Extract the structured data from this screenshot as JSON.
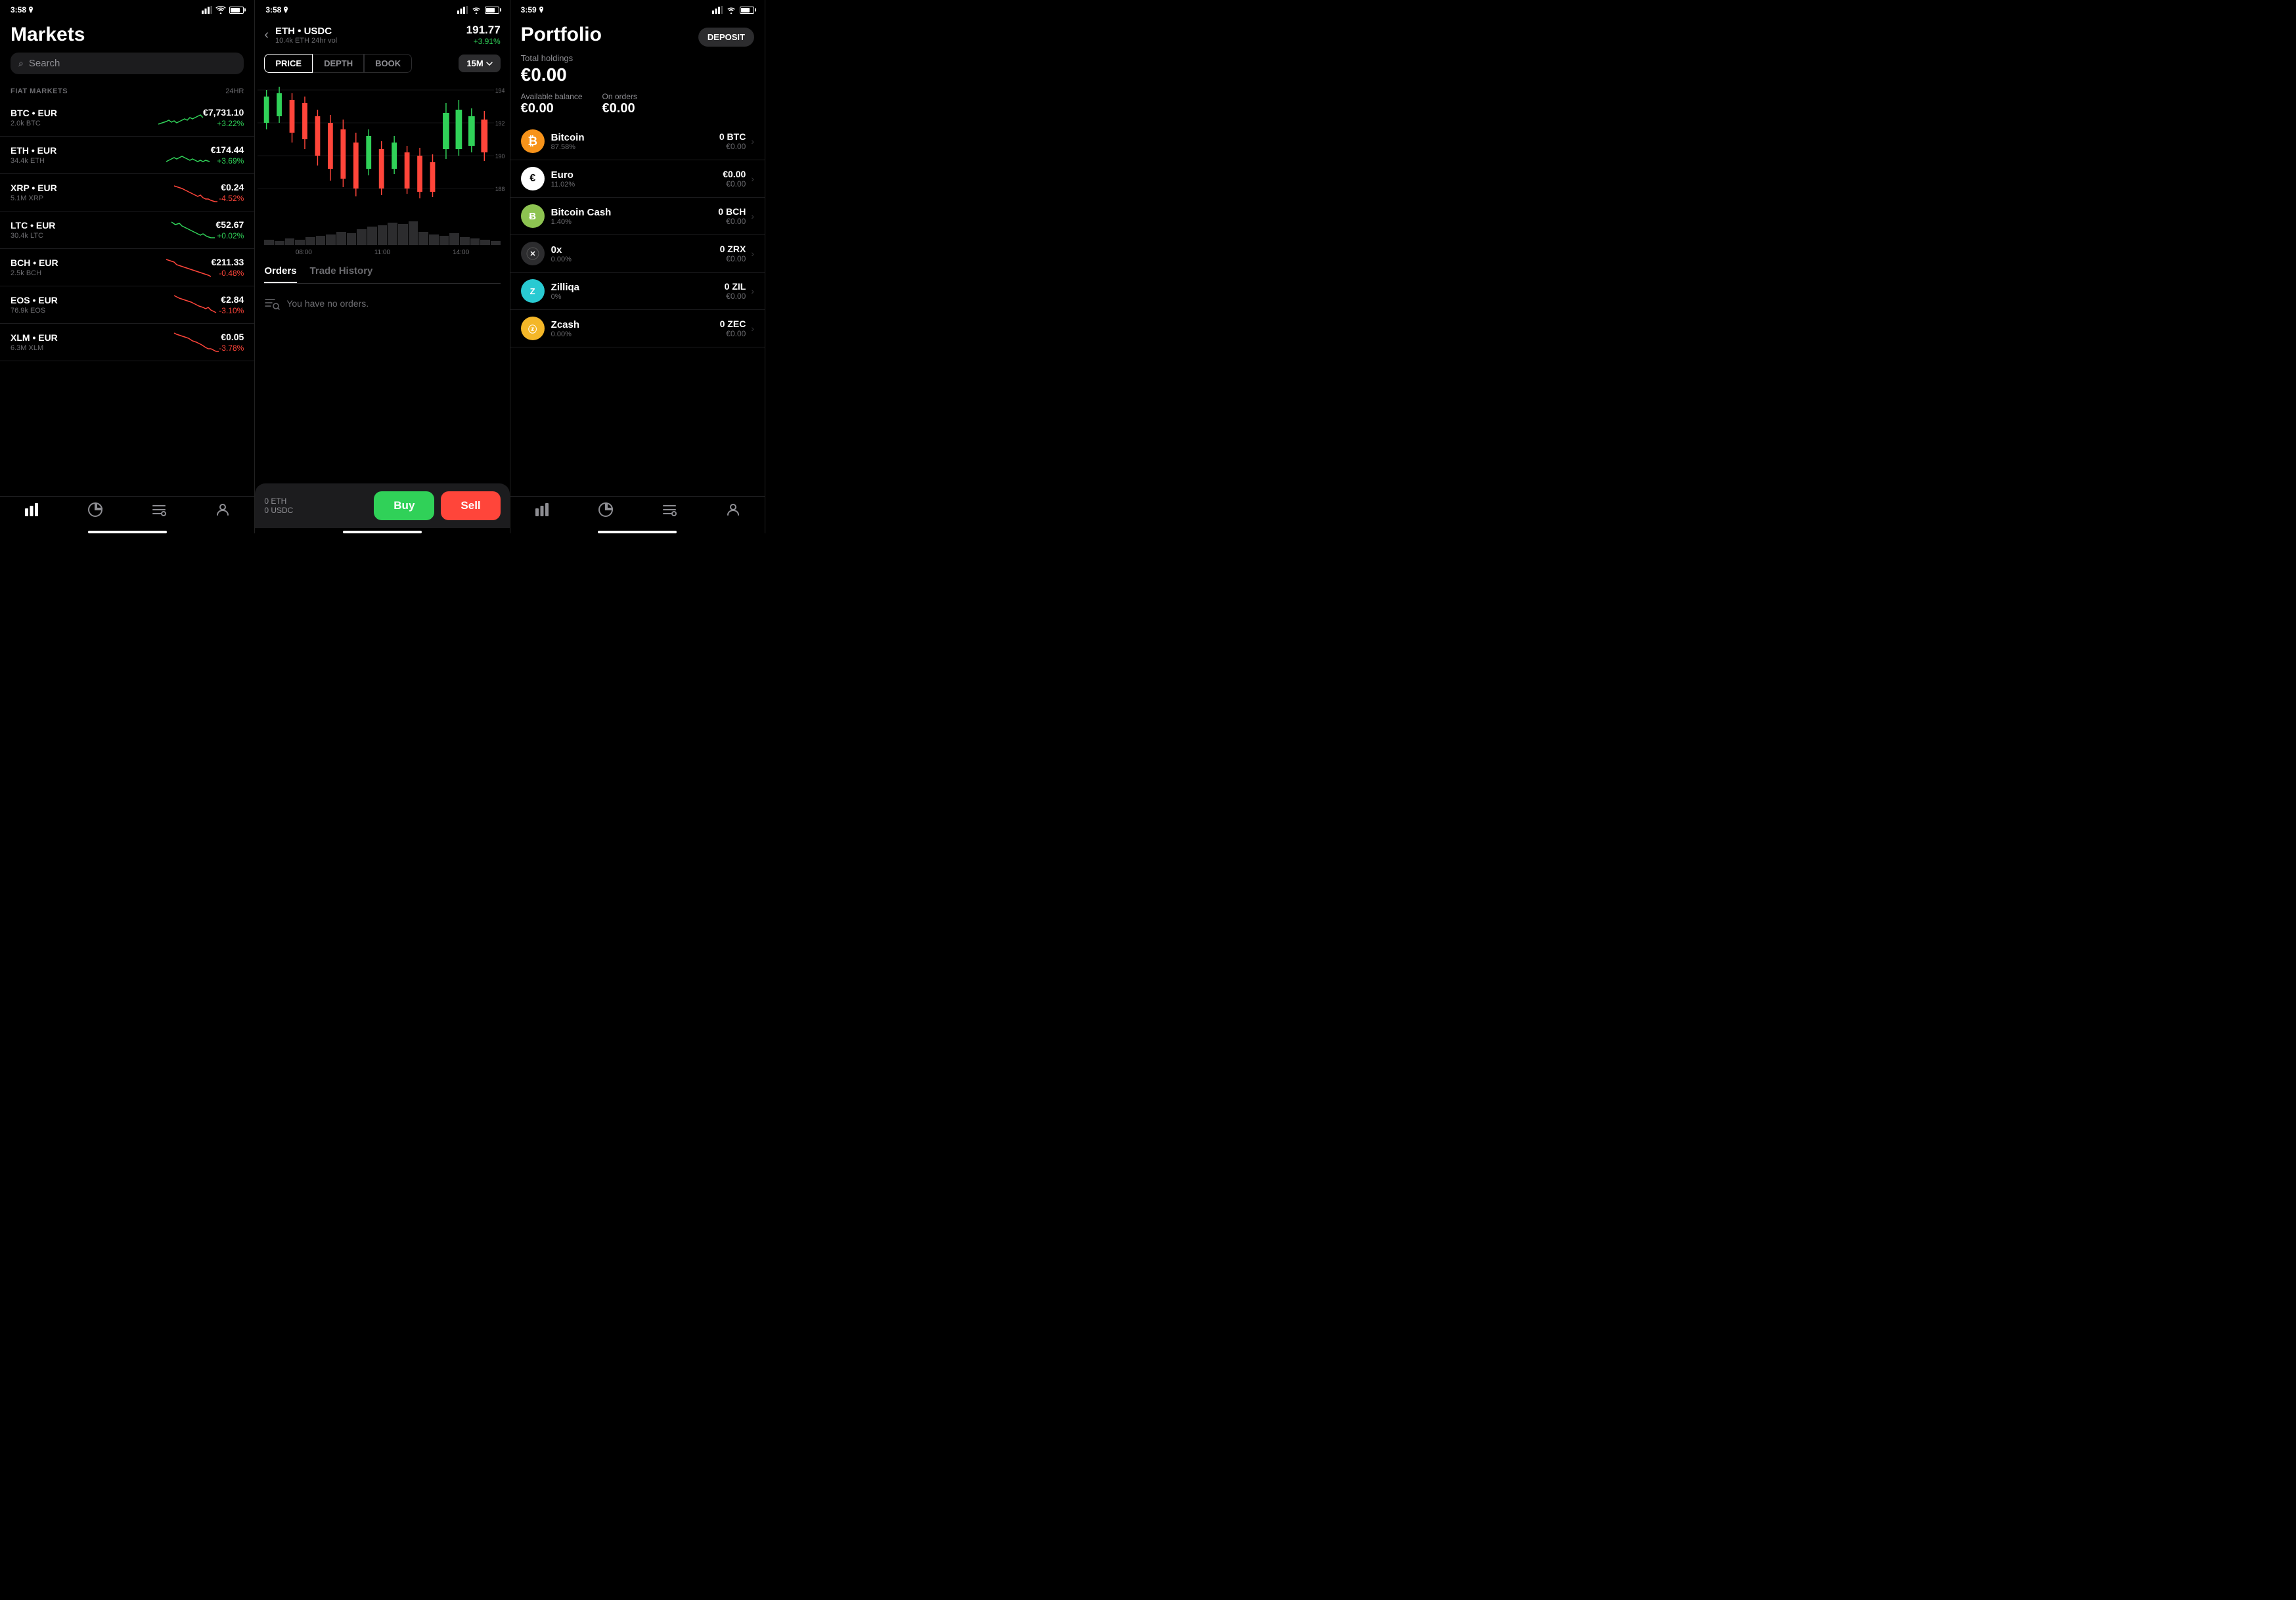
{
  "screens": {
    "markets": {
      "status_time": "3:58",
      "title": "Markets",
      "search_placeholder": "Search",
      "section_label": "FIAT MARKETS",
      "section_24hr": "24HR",
      "items": [
        {
          "pair": "BTC • EUR",
          "vol": "2.0k BTC",
          "price": "€7,731.10",
          "change": "+3.22%",
          "positive": true
        },
        {
          "pair": "ETH • EUR",
          "vol": "34.4k ETH",
          "price": "€174.44",
          "change": "+3.69%",
          "positive": true
        },
        {
          "pair": "XRP • EUR",
          "vol": "5.1M XRP",
          "price": "€0.24",
          "change": "-4.52%",
          "positive": false
        },
        {
          "pair": "LTC • EUR",
          "vol": "30.4k LTC",
          "price": "€52.67",
          "change": "+0.02%",
          "positive": true
        },
        {
          "pair": "BCH • EUR",
          "vol": "2.5k BCH",
          "price": "€211.33",
          "change": "-0.48%",
          "positive": false
        },
        {
          "pair": "EOS • EUR",
          "vol": "76.9k EOS",
          "price": "€2.84",
          "change": "-3.10%",
          "positive": false
        },
        {
          "pair": "XLM • EUR",
          "vol": "6.3M XLM",
          "price": "€0.05",
          "change": "-3.78%",
          "positive": false
        }
      ],
      "nav": [
        "markets",
        "portfolio",
        "orders",
        "account"
      ]
    },
    "trading": {
      "status_time": "3:58",
      "pair_name": "ETH • USDC",
      "pair_vol": "10.4k ETH 24hr vol",
      "price": "191.77",
      "price_change": "+3.91%",
      "tabs": [
        "PRICE",
        "DEPTH",
        "BOOK"
      ],
      "active_tab": "PRICE",
      "timeframe": "15M",
      "price_levels": [
        "194",
        "192",
        "190",
        "188"
      ],
      "time_labels": [
        "08:00",
        "11:00",
        "14:00"
      ],
      "orders_tabs": [
        "Orders",
        "Trade History"
      ],
      "no_orders_text": "You have no orders.",
      "eth_balance": "0 ETH",
      "usdc_balance": "0 USDC",
      "buy_label": "Buy",
      "sell_label": "Sell"
    },
    "portfolio": {
      "status_time": "3:59",
      "title": "Portfolio",
      "deposit_label": "DEPOSIT",
      "total_label": "Total holdings",
      "total_value": "€0.00",
      "available_label": "Available balance",
      "available_value": "€0.00",
      "on_orders_label": "On orders",
      "on_orders_value": "€0.00",
      "assets": [
        {
          "name": "Bitcoin",
          "pct": "87.58%",
          "crypto": "0 BTC",
          "fiat": "€0.00",
          "type": "btc",
          "symbol": "₿"
        },
        {
          "name": "Euro",
          "pct": "11.02%",
          "crypto": "€0.00",
          "fiat": "€0.00",
          "type": "eur",
          "symbol": "€"
        },
        {
          "name": "Bitcoin Cash",
          "pct": "1.40%",
          "crypto": "0 BCH",
          "fiat": "€0.00",
          "type": "bch",
          "symbol": "Ƀ"
        },
        {
          "name": "0x",
          "pct": "0.00%",
          "crypto": "0 ZRX",
          "fiat": "€0.00",
          "type": "zrx",
          "symbol": "✕"
        },
        {
          "name": "Zilliqa",
          "pct": "0%",
          "crypto": "0 ZIL",
          "fiat": "€0.00",
          "type": "zil",
          "symbol": "Z"
        },
        {
          "name": "Zcash",
          "pct": "0.00%",
          "crypto": "0 ZEC",
          "fiat": "€0.00",
          "type": "zec",
          "symbol": "ⓩ"
        }
      ]
    }
  }
}
